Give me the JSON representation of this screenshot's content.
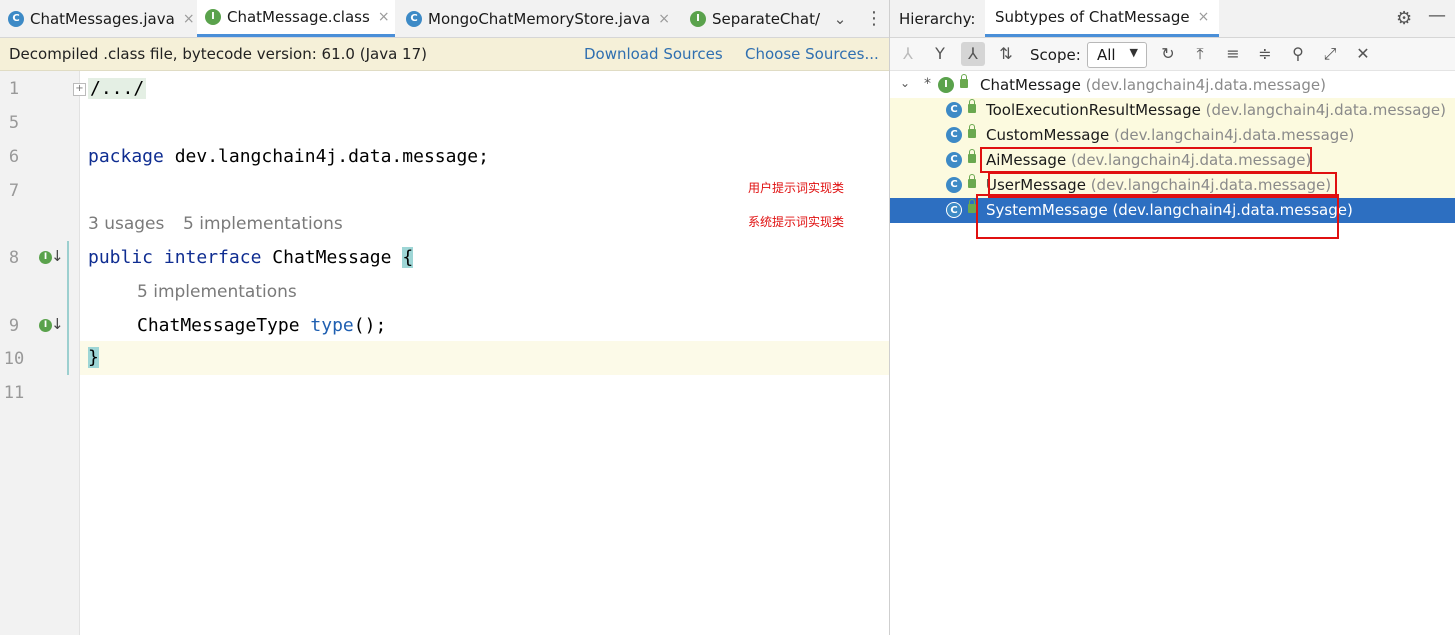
{
  "editor": {
    "tabs": [
      {
        "label": "ChatMessages.java",
        "icon": "C",
        "close": "×"
      },
      {
        "label": "ChatMessage.class",
        "icon": "I",
        "close": "×"
      },
      {
        "label": "MongoChatMemoryStore.java",
        "icon": "C",
        "close": "×"
      },
      {
        "label": "SeparateChat/",
        "icon": "I"
      }
    ],
    "tab_more": "⌄",
    "tab_menu": "⋮",
    "banner": {
      "text": "Decompiled .class file, bytecode version: 61.0 (Java 17)",
      "download": "Download Sources",
      "choose": "Choose Sources..."
    },
    "line_numbers": [
      "1",
      "5",
      "6",
      "7",
      "8",
      "9",
      "10",
      "11"
    ],
    "code": {
      "fold": "/.../",
      "package_kw": "package",
      "package_name": " dev.langchain4j.data.message;",
      "usages": "3 usages",
      "implementations": "5 implementations",
      "public_kw": "public",
      "interface_kw": "interface",
      "class_name": "ChatMessage",
      "brace_open": "{",
      "inner_hint": "5 implementations",
      "method_type": "ChatMessageType",
      "method_name": "type",
      "method_tail": "();",
      "brace_close": "}"
    },
    "annotations": {
      "user_note": "用户提示词实现类",
      "system_note": "系统提示词实现类"
    }
  },
  "hierarchy": {
    "label": "Hierarchy:",
    "tab": "Subtypes of ChatMessage",
    "tab_close": "×",
    "scope_label": "Scope:",
    "scope_value": "All",
    "tree": [
      {
        "name": "ChatMessage",
        "pkg": " (dev.langchain4j.data.message)",
        "icon": "I"
      },
      {
        "name": "ToolExecutionResultMessage",
        "pkg": " (dev.langchain4j.data.message)",
        "icon": "C"
      },
      {
        "name": "CustomMessage",
        "pkg": " (dev.langchain4j.data.message)",
        "icon": "C"
      },
      {
        "name": "AiMessage",
        "pkg": " (dev.langchain4j.data.message)",
        "icon": "C"
      },
      {
        "name": "UserMessage",
        "pkg": " (dev.langchain4j.data.message)",
        "icon": "C"
      },
      {
        "name": "SystemMessage",
        "pkg": " (dev.langchain4j.data.message)",
        "icon": "C"
      }
    ]
  },
  "colors": {
    "accent": "#4a8fd8",
    "selection": "#2d6fc1",
    "annotation_red": "#e01010",
    "class_icon": "#3d8ac6",
    "interface_icon": "#5aa24c"
  }
}
